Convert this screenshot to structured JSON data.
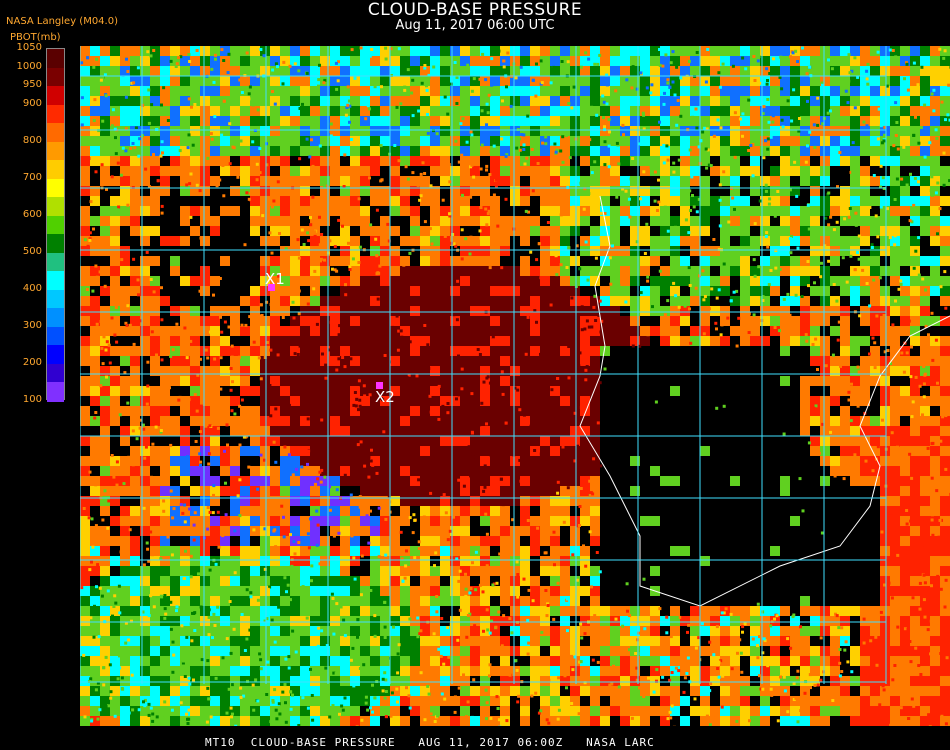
{
  "header": {
    "title": "CLOUD-BASE PRESSURE",
    "subtitle": "Aug 11, 2017 06:00 UTC",
    "source": "NASA Langley (M04.0)",
    "parameter": "PBOT(mb)"
  },
  "legend": {
    "ticks": [
      "1050",
      "1000",
      "950",
      "900",
      "850",
      "800",
      "750",
      "700",
      "650",
      "600",
      "550",
      "500",
      "450",
      "400",
      "350",
      "300",
      "250",
      "200",
      "150",
      "100"
    ],
    "shown_ticks": [
      "1050",
      "1000",
      "950",
      "900",
      "800",
      "700",
      "600",
      "500",
      "400",
      "300",
      "200",
      "100"
    ],
    "colors": [
      "#5a0000",
      "#7a0000",
      "#d00000",
      "#ff2a00",
      "#ff6a00",
      "#ff9a00",
      "#ffcc00",
      "#ffff00",
      "#b0e000",
      "#50d000",
      "#008000",
      "#20c080",
      "#00ffff",
      "#00c8ff",
      "#0090ff",
      "#0050ff",
      "#0000ff",
      "#3000d0",
      "#8030ff"
    ]
  },
  "markers": [
    {
      "label": "X1",
      "color": "#ff33ff"
    },
    {
      "label": "X2",
      "color": "#ff33ff"
    }
  ],
  "footer": {
    "text": "MT10  CLOUD-BASE PRESSURE   AUG 11, 2017 06:00Z   NASA LARC"
  },
  "palette": {
    "dark_red": "#6a0000",
    "red": "#ff2200",
    "orange": "#ff7a00",
    "yellow": "#ffd000",
    "green": "#60d020",
    "dark_green": "#008000",
    "cyan": "#00ffff",
    "blue": "#1070ff",
    "violet": "#7030ff",
    "grid": "#40e0ff",
    "coast": "#ffffff"
  }
}
